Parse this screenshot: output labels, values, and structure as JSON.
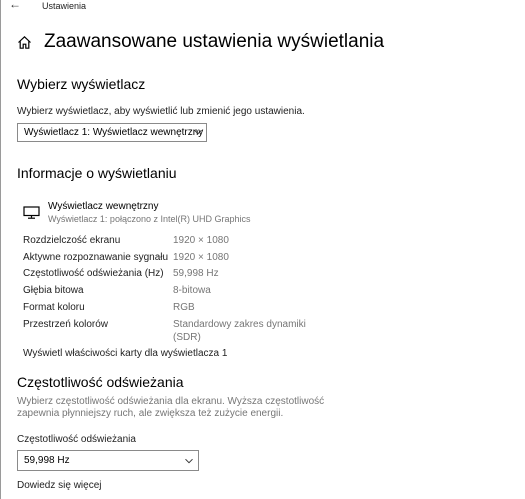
{
  "titlebar": {
    "back_icon": "back-arrow-icon",
    "app_title": "Ustawienia"
  },
  "header": {
    "home_icon": "home-icon",
    "title": "Zaawansowane ustawienia wyświetlania"
  },
  "choose_display": {
    "heading": "Wybierz wyświetlacz",
    "description": "Wybierz wyświetlacz, aby wyświetlić lub zmienić jego ustawienia.",
    "selected": "Wyświetlacz 1: Wyświetlacz wewnętrzny"
  },
  "display_info": {
    "heading": "Informacje o wyświetlaniu",
    "monitor_icon": "monitor-icon",
    "monitor_name": "Wyświetlacz wewnętrzny",
    "monitor_connection": "Wyświetlacz 1: połączono z Intel(R) UHD Graphics",
    "rows": [
      {
        "label": "Rozdzielczość ekranu",
        "value": "1920 × 1080"
      },
      {
        "label": "Aktywne rozpoznawanie sygnału",
        "value": "1920 × 1080"
      },
      {
        "label": "Częstotliwość odświeżania (Hz)",
        "value": "59,998 Hz"
      },
      {
        "label": "Głębia bitowa",
        "value": "8-bitowa"
      },
      {
        "label": "Format koloru",
        "value": "RGB"
      },
      {
        "label": "Przestrzeń kolorów",
        "value": "Standardowy zakres dynamiki",
        "value2": "(SDR)"
      }
    ],
    "adapter_link": "Wyświetl właściwości karty dla wyświetlacza 1"
  },
  "refresh_rate": {
    "heading": "Częstotliwość odświeżania",
    "description_line1": "Wybierz częstotliwość odświeżania dla ekranu. Wyższa częstotliwość",
    "description_line2": "zapewnia płynniejszy ruch, ale zwiększa też zużycie energii.",
    "field_label": "Częstotliwość odświeżania",
    "selected": "59,998 Hz",
    "learn_more": "Dowiedz się więcej"
  },
  "colors": {
    "text": "#000000",
    "secondary_text": "#767676",
    "border": "#8a8a8a"
  }
}
